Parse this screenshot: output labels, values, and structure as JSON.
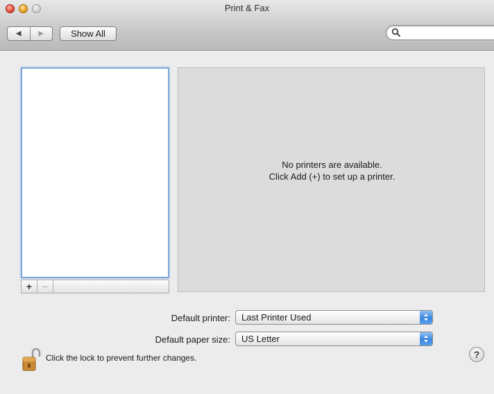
{
  "window": {
    "title": "Print & Fax"
  },
  "toolbar": {
    "back_glyph": "◀",
    "forward_glyph": "▶",
    "show_all_label": "Show All",
    "search": {
      "value": "",
      "placeholder": ""
    }
  },
  "printer_list": {
    "items": [],
    "add_label": "+",
    "remove_label": "−"
  },
  "detail": {
    "empty_line1": "No printers are available.",
    "empty_line2": "Click Add (+) to set up a printer."
  },
  "settings": {
    "default_printer": {
      "label": "Default printer:",
      "value": "Last Printer Used"
    },
    "default_paper_size": {
      "label": "Default paper size:",
      "value": "US Letter"
    }
  },
  "footer": {
    "lock_text": "Click the lock to prevent further changes.",
    "help_label": "?"
  },
  "colors": {
    "accent": "#3b86e0",
    "selection_border": "#7ea6d8",
    "panel": "#dcdcdc"
  },
  "icons": [
    "search-icon",
    "lock-open-icon",
    "help-icon",
    "chevron-updown-icon"
  ]
}
